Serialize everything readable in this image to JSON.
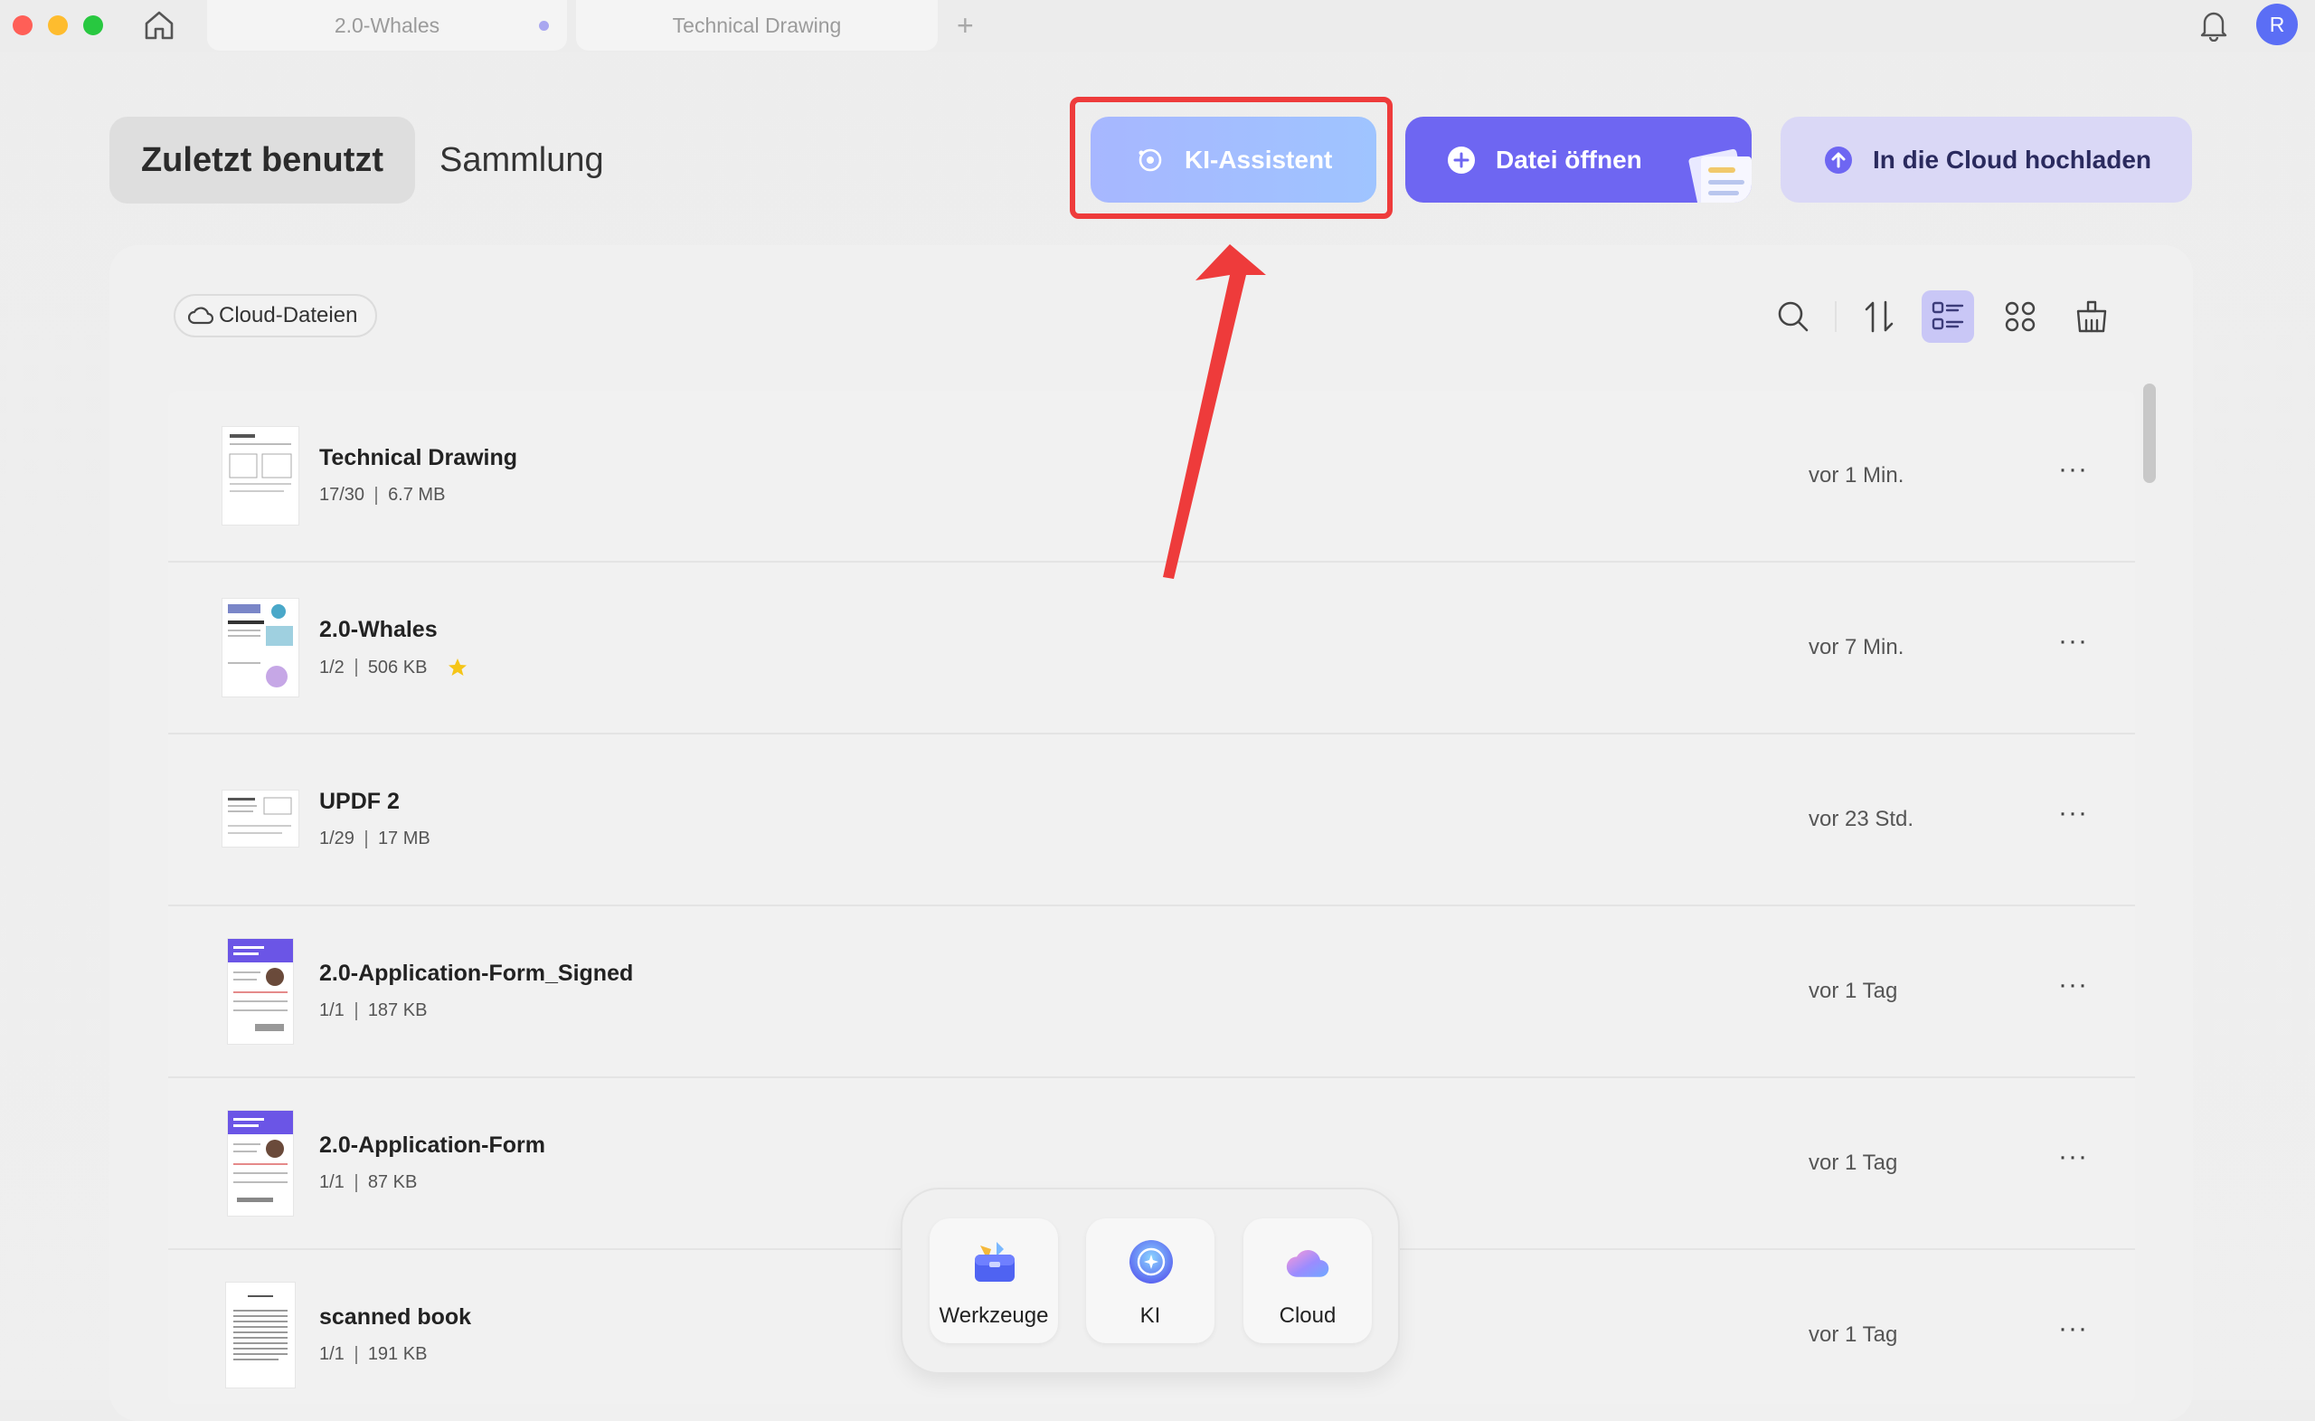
{
  "window": {
    "tabs": [
      {
        "label": "2.0-Whales",
        "has_unsaved_dot": true
      },
      {
        "label": "Technical Drawing"
      }
    ],
    "new_tab_label": "+",
    "avatar_initial": "R"
  },
  "header": {
    "segments": [
      "Zuletzt benutzt",
      "Sammlung"
    ],
    "ki_button": "KI-Assistent",
    "open_button": "Datei öffnen",
    "cloud_button": "In die Cloud hochladen"
  },
  "toolbar": {
    "cloud_files_label": "Cloud-Dateien",
    "icons": [
      "search-icon",
      "sort-icon",
      "list-view-icon",
      "grid-view-icon",
      "clean-icon"
    ],
    "active_view": "list"
  },
  "files": [
    {
      "name": "Technical Drawing",
      "pages": "17/30",
      "size": "6.7 MB",
      "time": "vor 1 Min.",
      "starred": false
    },
    {
      "name": "2.0-Whales",
      "pages": "1/2",
      "size": "506 KB",
      "time": "vor 7 Min.",
      "starred": true
    },
    {
      "name": "UPDF 2",
      "pages": "1/29",
      "size": "17 MB",
      "time": "vor 23 Std.",
      "starred": false
    },
    {
      "name": "2.0-Application-Form_Signed",
      "pages": "1/1",
      "size": "187 KB",
      "time": "vor 1 Tag",
      "starred": false
    },
    {
      "name": "2.0-Application-Form",
      "pages": "1/1",
      "size": "87 KB",
      "time": "vor 1 Tag",
      "starred": false
    },
    {
      "name": "scanned book",
      "pages": "1/1",
      "size": "191 KB",
      "time": "vor 1 Tag",
      "starred": false
    }
  ],
  "more_label": "···",
  "dock": [
    {
      "label": "Werkzeuge",
      "icon": "toolbox-icon"
    },
    {
      "label": "KI",
      "icon": "ai-icon"
    },
    {
      "label": "Cloud",
      "icon": "cloud-icon"
    }
  ],
  "colors": {
    "accent": "#6e66f2",
    "ki_gradient_start": "#a7b7ff",
    "ki_gradient_end": "#9fc4ff",
    "highlight": "#ee3b3b",
    "star": "#f5c518"
  }
}
